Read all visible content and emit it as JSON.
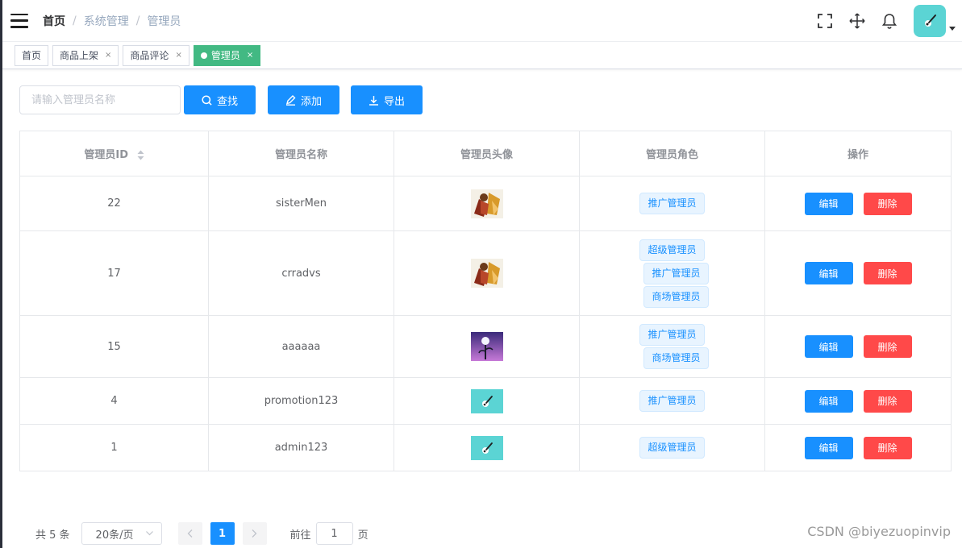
{
  "breadcrumb": [
    "首页",
    "系统管理",
    "管理员"
  ],
  "tags": [
    {
      "label": "首页",
      "closable": false,
      "active": false
    },
    {
      "label": "商品上架",
      "closable": true,
      "active": false
    },
    {
      "label": "商品评论",
      "closable": true,
      "active": false
    },
    {
      "label": "管理员",
      "closable": true,
      "active": true
    }
  ],
  "toolbar": {
    "search_placeholder": "请输入管理员名称",
    "search_label": "查找",
    "add_label": "添加",
    "export_label": "导出"
  },
  "table": {
    "columns": [
      "管理员ID",
      "管理员名称",
      "管理员头像",
      "管理员角色",
      "操作"
    ],
    "rows": [
      {
        "id": "22",
        "name": "sisterMen",
        "avatar": "warrior",
        "roles": [
          "推广管理员"
        ]
      },
      {
        "id": "17",
        "name": "crradvs",
        "avatar": "warrior",
        "roles": [
          "超级管理员",
          "推广管理员",
          "商场管理员"
        ]
      },
      {
        "id": "15",
        "name": "aaaaaa",
        "avatar": "flower",
        "roles": [
          "推广管理员",
          "商场管理员"
        ]
      },
      {
        "id": "4",
        "name": "promotion123",
        "avatar": "teal-logo",
        "roles": [
          "推广管理员"
        ]
      },
      {
        "id": "1",
        "name": "admin123",
        "avatar": "teal-logo",
        "roles": [
          "超级管理员"
        ]
      }
    ],
    "edit_label": "编辑",
    "delete_label": "删除"
  },
  "pagination": {
    "total_text": "共 5 条",
    "page_size": "20条/页",
    "current_page": "1",
    "goto_prefix": "前往",
    "goto_value": "1",
    "goto_suffix": "页"
  },
  "watermark": "CSDN @biyezuopinvip",
  "colors": {
    "primary": "#1890ff",
    "danger": "#ff4949",
    "active_tag": "#42b983",
    "avatar_bg": "#5bd4d4"
  }
}
